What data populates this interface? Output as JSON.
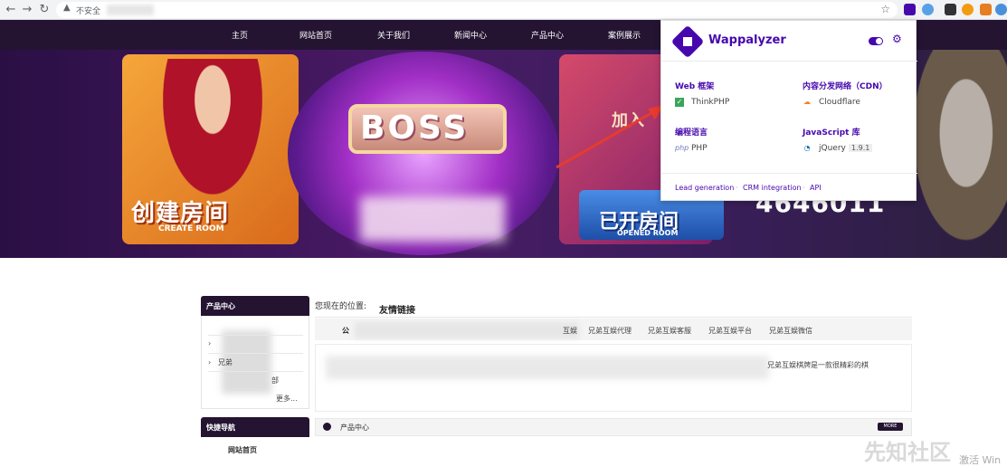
{
  "browser": {
    "security_label": "不安全",
    "back_icon": "arrow-left-icon",
    "forward_icon": "arrow-right-icon",
    "reload_icon": "reload-icon"
  },
  "site": {
    "menu": [
      "主页",
      "网站首页",
      "关于我们",
      "新闻中心",
      "产品中心",
      "案例展示"
    ]
  },
  "banner": {
    "left_card_title": "创建房间",
    "left_card_sub": "CREATE ROOM",
    "center_text": "BOSS",
    "right_card_top": "加入",
    "right_card_title": "已开房间",
    "right_card_sub": "OPENED ROOM",
    "number": "4646011"
  },
  "wappalyzer": {
    "title": "Wappalyzer",
    "categories": [
      {
        "name": "Web 框架",
        "tech": "ThinkPHP",
        "icon": "thinkphp-icon"
      },
      {
        "name": "内容分发网络（CDN）",
        "tech": "Cloudflare",
        "icon": "cloudflare-icon"
      },
      {
        "name": "编程语言",
        "tech": "PHP",
        "icon": "php-icon"
      },
      {
        "name": "JavaScript 库",
        "tech": "jQuery",
        "version": "1.9.1",
        "icon": "jquery-icon"
      }
    ],
    "links": [
      "Lead generation",
      "CRM integration",
      "API"
    ]
  },
  "sidebar": {
    "product_heading": "产品中心",
    "item_partial": "兄弟",
    "item_suffix": "部",
    "more": "更多...",
    "quick_nav_heading": "快捷导航",
    "quick_nav_item": "网站首页"
  },
  "main": {
    "location_label": "您现在的位置:",
    "location_title": "友情链接",
    "links_first": "公",
    "links": [
      "互娱",
      "兄弟互娱代理",
      "兄弟互娱客服",
      "兄弟互娱平台",
      "兄弟互娱微信"
    ],
    "content_tail": "兄弟互娱棋牌是一款很精彩的棋",
    "product_heading": "产品中心",
    "more_button": "MORE"
  },
  "watermark": "先知社区",
  "activate": "激活 Win"
}
